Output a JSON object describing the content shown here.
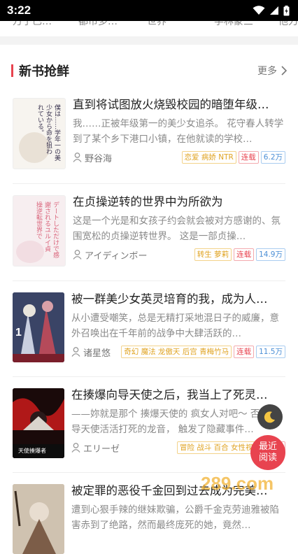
{
  "status": {
    "time": "3:22"
  },
  "top_tabs": [
    "万于已…",
    "都市多…",
    "世界",
    "学林蒙三",
    "他力…"
  ],
  "section": {
    "title": "新书抢鲜",
    "more": "更多"
  },
  "books": [
    {
      "title": "直到将试图放火烧毁校园的暗堕年级…",
      "desc": "我……正被年级第一的美少女追杀。 花守春人转学到了某个乡下港口小镇，在他就读的学校…",
      "author": "野谷海",
      "tags": [
        {
          "text": "恋爱 病娇 NTR",
          "color": "yellow"
        },
        {
          "text": "连载",
          "color": "red"
        },
        {
          "text": "6.2万",
          "color": "blue"
        }
      ],
      "cover_text": [
        "僕は……学年一の美",
        "少女から命を狙わ",
        "れている。"
      ],
      "cover_colors": {
        "bg": "#f7f4ef",
        "text": "#3b3550"
      }
    },
    {
      "title": "在贞操逆转的世界中为所欲为",
      "desc": "这是一个光是和女孩子约会就会被对方感谢的、氛围宽松的贞操逆转世界。 这是一部贞操…",
      "author": "アイディンボー",
      "tags": [
        {
          "text": "转生 萝莉",
          "color": "yellow"
        },
        {
          "text": "连载",
          "color": "red"
        },
        {
          "text": "14.9万",
          "color": "blue"
        }
      ],
      "cover_text": [
        "デートしただけで感",
        "謝されるユルイ貞",
        "操逆転世界で"
      ],
      "cover_colors": {
        "bg": "#f7eef0",
        "text": "#d9637a"
      }
    },
    {
      "title": "被一群美少女英灵培育的我，成为人…",
      "desc": "从小遭受嘲笑，总是无精打采地混日子的威廉，意外召唤出在千年前的战争中大肆活跃的…",
      "author": "诸星悠",
      "tags": [
        {
          "text": "奇幻 魔法 龙傲天 后宫 青梅竹马",
          "color": "yellow"
        },
        {
          "text": "连载",
          "color": "red"
        },
        {
          "text": "11.5万",
          "color": "blue"
        }
      ],
      "cover_text": [
        "1"
      ],
      "cover_colors": {
        "bg": "#2c3550",
        "text": "#ffffff"
      }
    },
    {
      "title": "在揍爆向导天使之后，我当上了死灵…",
      "desc": "——妳就是那个 揍爆天使的 疯女人对吧～ 否可向导天使活活打死的龙音， 触发了隐藏事件…",
      "author": "エリーゼ",
      "tags": [
        {
          "text": "冒险 战斗 百合 女性视角",
          "color": "yellow"
        },
        {
          "text": "连载",
          "color": "red"
        }
      ],
      "cover_text": [
        "天使揍爆者"
      ],
      "cover_colors": {
        "bg": "#1a0a0a",
        "text": "#ffffff"
      }
    },
    {
      "title": "被定罪的恶役千金回到过去成为完美…",
      "desc": "遭到心狠手辣的继妹欺骗，公爵千金克劳迪雅被陷害赤到了绝路，然而最终庞死的她，竟然…",
      "author": "",
      "tags": [],
      "cover_text": [],
      "cover_colors": {
        "bg": "#cfc2b0",
        "text": "#3a2c20"
      }
    }
  ],
  "fab": {
    "night_icon": "moon-icon",
    "recent_label_1": "最近",
    "recent_label_2": "阅读"
  },
  "watermark": "289.com"
}
